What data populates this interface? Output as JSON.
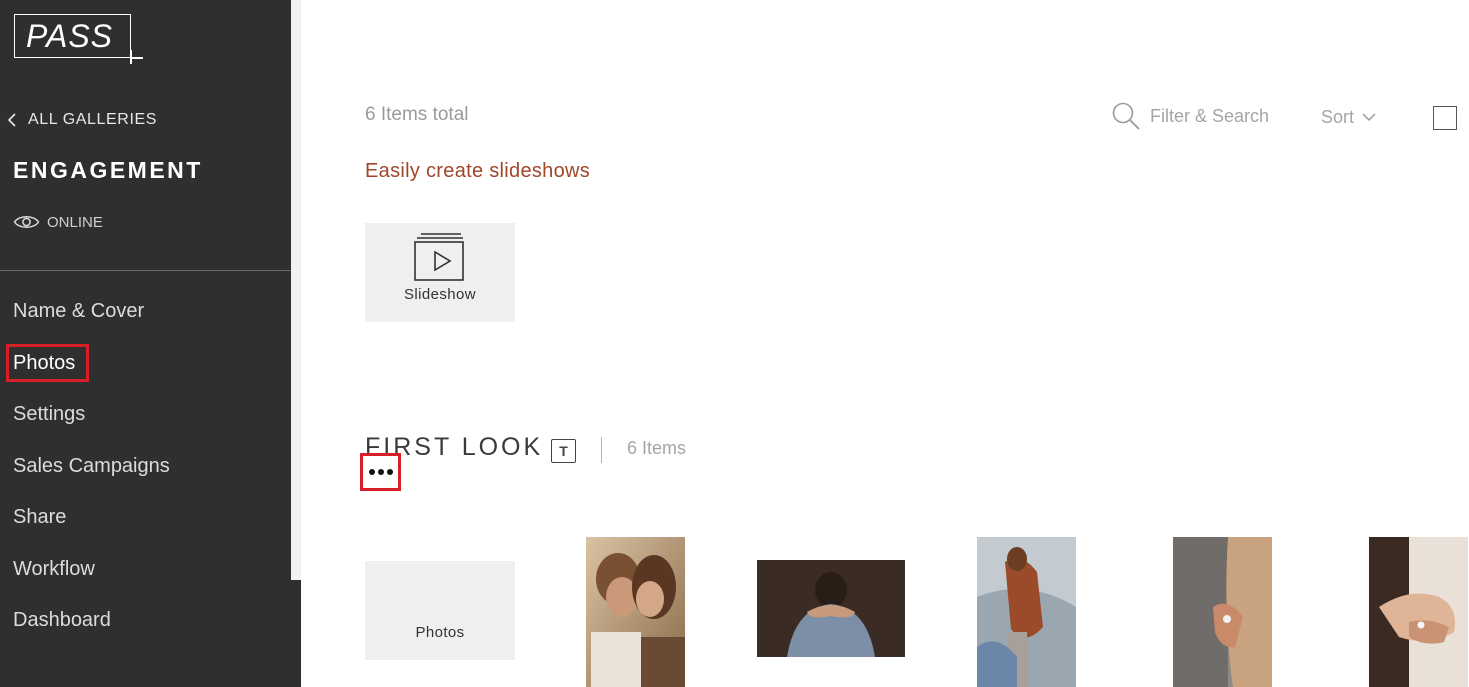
{
  "sidebar": {
    "logo_text": "PASS",
    "back_label": "ALL GALLERIES",
    "gallery_title": "ENGAGEMENT",
    "status_label": "ONLINE",
    "nav": [
      {
        "label": "Name & Cover"
      },
      {
        "label": "Photos",
        "active": true
      },
      {
        "label": "Settings"
      },
      {
        "label": "Sales Campaigns"
      },
      {
        "label": "Share"
      },
      {
        "label": "Workflow"
      },
      {
        "label": "Dashboard"
      }
    ]
  },
  "toolbar": {
    "items_total": "6 Items total",
    "filter_label": "Filter & Search",
    "sort_label": "Sort"
  },
  "slideshow": {
    "link_label": "Easily create slideshows",
    "tile_label": "Slideshow"
  },
  "set": {
    "title": "FIRST LOOK",
    "count": "6 Items",
    "t_glyph": "T",
    "photos_tile_label": "Photos"
  },
  "colors": {
    "sidebar_bg": "#2f2f2f",
    "highlight": "#d91e2a",
    "accent_link": "#a0472a"
  }
}
